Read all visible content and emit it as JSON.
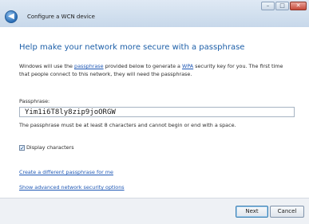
{
  "window": {
    "title": "Configure a WCN device",
    "buttons": {
      "minimize": "–",
      "maximize": "□",
      "close": "✕"
    }
  },
  "nav": {
    "back_icon": "back-arrow-icon",
    "back_glyph": "◀"
  },
  "main": {
    "heading": "Help make your network more secure with a passphrase",
    "description": {
      "part1": "Windows will use the ",
      "link1": "passphrase",
      "part2": " provided below to generate a ",
      "link2": "WPA",
      "part3": " security key for you. The first time that people connect to this network, they will need the passphrase."
    },
    "passphrase_label": "Passphrase:",
    "passphrase_value": "Yim1i6T8ly8zip9joORGW",
    "passphrase_hint": "The passphrase must be at least 8 characters and cannot begin or end with a space.",
    "display_characters": {
      "label": "Display characters",
      "checked": true,
      "check_glyph": "✓"
    },
    "links": {
      "different_passphrase": "Create a different passphrase for me",
      "advanced_options": "Show advanced network security options"
    }
  },
  "footer": {
    "next": "Next",
    "cancel": "Cancel"
  },
  "colors": {
    "heading": "#1d5fa8",
    "link": "#1f58b5",
    "titlebar": "#c7d8ea"
  }
}
